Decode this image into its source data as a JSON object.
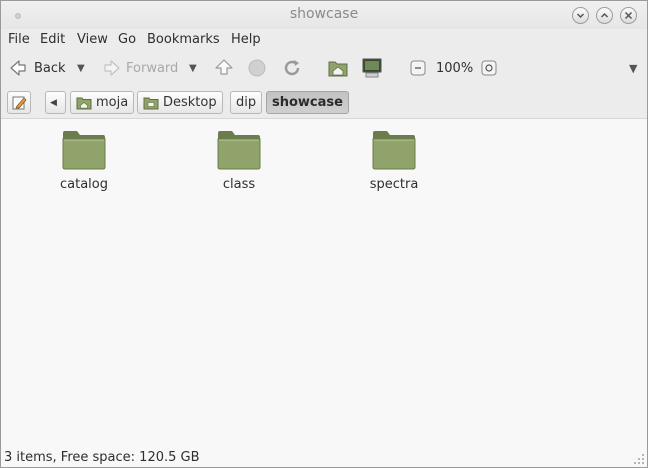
{
  "window": {
    "title": "showcase"
  },
  "menubar": {
    "items": [
      "File",
      "Edit",
      "View",
      "Go",
      "Bookmarks",
      "Help"
    ]
  },
  "toolbar": {
    "back_label": "Back",
    "forward_label": "Forward",
    "zoom_level": "100%"
  },
  "pathbar": {
    "segments": [
      "moja",
      "Desktop",
      "dip",
      "showcase"
    ],
    "active": "showcase"
  },
  "content": {
    "items": [
      {
        "name": "catalog",
        "type": "folder"
      },
      {
        "name": "class",
        "type": "folder"
      },
      {
        "name": "spectra",
        "type": "folder"
      }
    ]
  },
  "statusbar": {
    "text": "3 items, Free space: 120.5 GB"
  },
  "colors": {
    "folder": "#8fa36a",
    "folder_dark": "#6b7d4c",
    "content_bg": "#f8f8f8"
  }
}
